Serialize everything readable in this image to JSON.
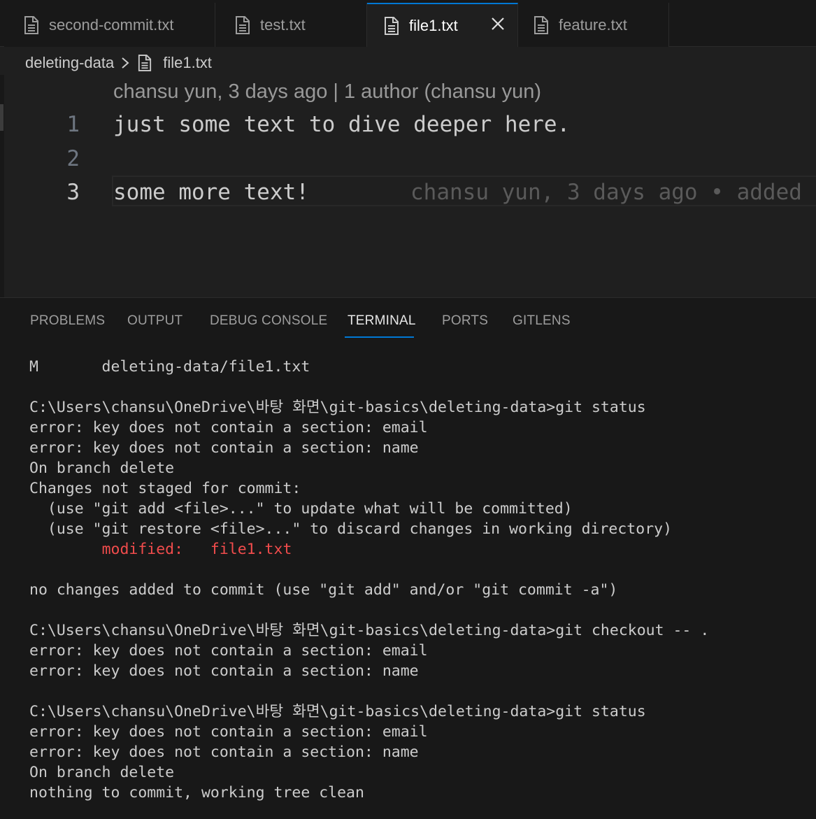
{
  "tabs": [
    {
      "label": "second-commit.txt",
      "active": false
    },
    {
      "label": "test.txt",
      "active": false
    },
    {
      "label": "file1.txt",
      "active": true
    },
    {
      "label": "feature.txt",
      "active": false
    }
  ],
  "breadcrumb": {
    "folder": "deleting-data",
    "file": "file1.txt"
  },
  "editor": {
    "codelens": "chansu yun, 3 days ago | 1 author (chansu yun)",
    "lines": [
      {
        "num": "1",
        "text": "just some text to dive deeper here."
      },
      {
        "num": "2",
        "text": ""
      },
      {
        "num": "3",
        "text": "some more text!",
        "blame": "chansu yun, 3 days ago • added"
      }
    ]
  },
  "panel": {
    "tabs": [
      "PROBLEMS",
      "OUTPUT",
      "DEBUG CONSOLE",
      "TERMINAL",
      "PORTS",
      "GITLENS"
    ],
    "active_tab": "TERMINAL"
  },
  "terminal": {
    "lines": [
      "M       deleting-data/file1.txt",
      "",
      "C:\\Users\\chansu\\OneDrive\\바탕 화면\\git-basics\\deleting-data>git status",
      "error: key does not contain a section: email",
      "error: key does not contain a section: name",
      "On branch delete",
      "Changes not staged for commit:",
      "  (use \"git add <file>...\" to update what will be committed)",
      "  (use \"git restore <file>...\" to discard changes in working directory)",
      "        modified:   file1.txt",
      "",
      "no changes added to commit (use \"git add\" and/or \"git commit -a\")",
      "",
      "C:\\Users\\chansu\\OneDrive\\바탕 화면\\git-basics\\deleting-data>git checkout -- .",
      "error: key does not contain a section: email",
      "error: key does not contain a section: name",
      "",
      "C:\\Users\\chansu\\OneDrive\\바탕 화면\\git-basics\\deleting-data>git status",
      "error: key does not contain a section: email",
      "error: key does not contain a section: name",
      "On branch delete",
      "nothing to commit, working tree clean"
    ],
    "colors": {
      "text": "#cccccc",
      "modified": "#f14c4c"
    }
  },
  "colors": {
    "accent": "#0078d4",
    "background": "#1f1f1f",
    "panel": "#181818"
  }
}
